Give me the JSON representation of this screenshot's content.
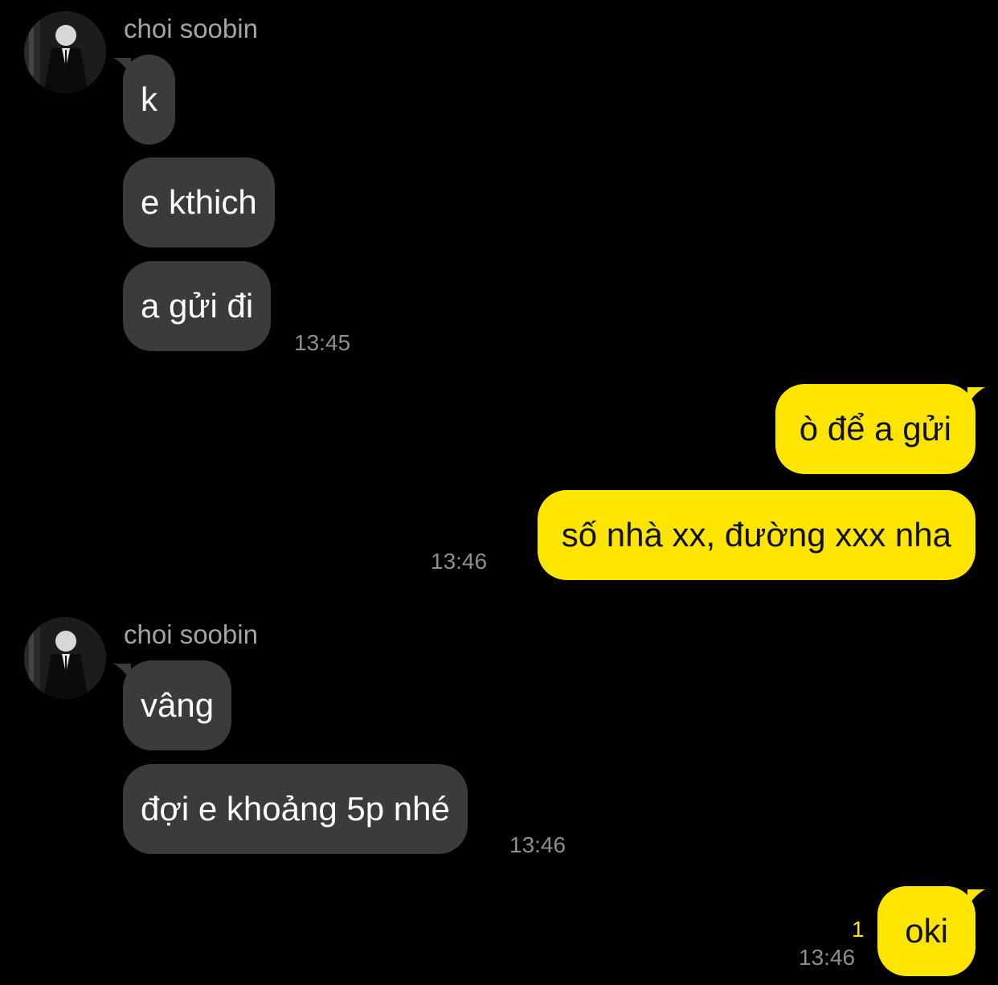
{
  "groups": [
    {
      "sender": "choi soobin",
      "messages": [
        "k",
        "e kthich",
        "a gửi đi"
      ],
      "time": "13:45"
    },
    {
      "sender": "choi soobin",
      "messages": [
        "vâng",
        "đợi e khoảng 5p nhé"
      ],
      "time": "13:46"
    }
  ],
  "outgoing": [
    {
      "messages": [
        "ò để a gửi",
        "số nhà xx, đường xxx nha"
      ],
      "time": "13:46"
    },
    {
      "messages": [
        "oki"
      ],
      "time": "13:46",
      "unread_count": "1"
    }
  ],
  "colors": {
    "background": "#000000",
    "incoming_bubble": "#3b3b3d",
    "outgoing_bubble": "#fee500",
    "unread": "#fee500"
  },
  "icons": {
    "avatar": "profile-photo-avatar"
  }
}
